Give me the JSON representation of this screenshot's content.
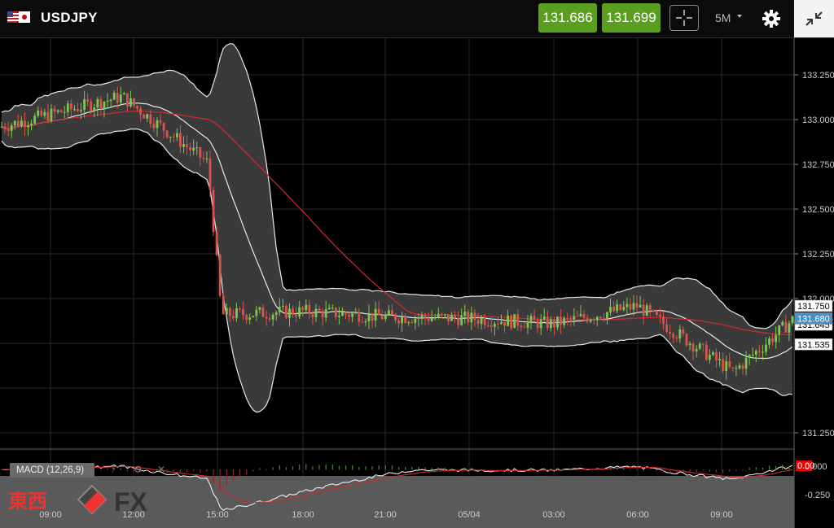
{
  "header": {
    "symbol": "USDJPY",
    "sell_price": "131.686",
    "buy_price": "131.699",
    "interval": "5M",
    "buy_sell_color": "#5a9e1f"
  },
  "icons": {
    "flags": "us-flag, jp-flag",
    "crosshair": "crosshair-icon",
    "settings": "gear-icon",
    "expand": "collapse-arrows-icon"
  },
  "indicator": {
    "macd_label": "MACD (12,26,9)"
  },
  "watermark": {
    "brand_cjk": "東西",
    "brand_latin": "FX"
  },
  "chart_data": {
    "type": "candlestick",
    "y_ticks": [
      "133.250",
      "133.000",
      "132.750",
      "132.500",
      "132.250",
      "132.000",
      "131.250"
    ],
    "x_ticks": [
      "09:00",
      "12:00",
      "15:00",
      "18:00",
      "21:00",
      "05/04",
      "03:00",
      "06:00",
      "09:00"
    ],
    "price_labels": {
      "upper": "131.750",
      "current": "131.680",
      "partial": "131.645",
      "lower": "131.535"
    },
    "macd_ticks": [
      "0.00",
      "0.000",
      "-0.250"
    ],
    "ylim": [
      131.1,
      133.4
    ],
    "indicators": [
      "Bollinger Bands",
      "Moving Average",
      "MACD (12,26,9)"
    ],
    "colors": {
      "bull": "#7ec850",
      "bear": "#d9534f",
      "band_line": "#e8e8e8",
      "band_fill": "#3a3a3a",
      "ma_line": "#d42b2b"
    },
    "price_path_anchors": [
      {
        "x": "09:00",
        "y": 132.75
      },
      {
        "x": "12:00",
        "y": 132.92
      },
      {
        "x": "15:00",
        "y": 132.55
      },
      {
        "x": "15:15",
        "y": 131.7
      },
      {
        "x": "18:00",
        "y": 131.72
      },
      {
        "x": "21:00",
        "y": 131.69
      },
      {
        "x": "05/04",
        "y": 131.68
      },
      {
        "x": "03:00",
        "y": 131.65
      },
      {
        "x": "06:00",
        "y": 131.75
      },
      {
        "x": "09:00",
        "y": 131.38
      },
      {
        "x": "last",
        "y": 131.68
      }
    ]
  }
}
